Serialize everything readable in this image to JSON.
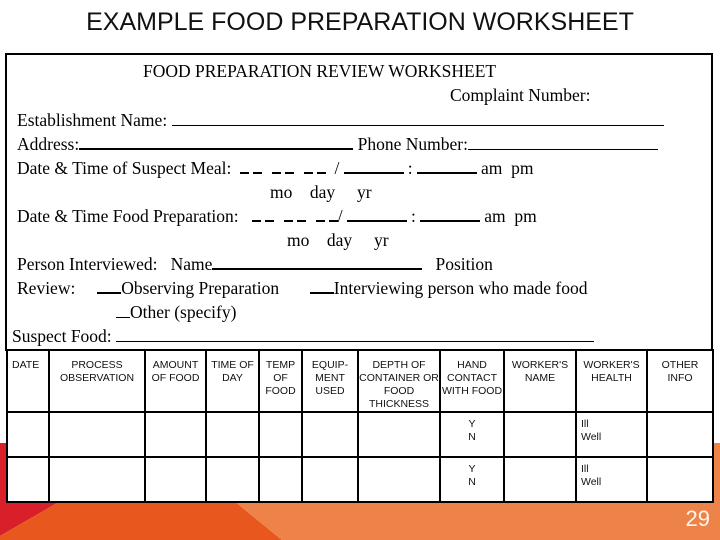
{
  "slide": {
    "title": "EXAMPLE FOOD PREPARATION WORKSHEET",
    "page_number": "29",
    "colors": {
      "red": "#d9202a",
      "dark_orange": "#e8581e",
      "light_orange": "#ee834a"
    }
  },
  "form": {
    "heading": "FOOD PREPARATION REVIEW WORKSHEET",
    "complaint_label": "Complaint Number:",
    "establishment_label": "Establishment Name:",
    "address_label": "Address:",
    "phone_label": "Phone Number:",
    "suspect_meal_label": "Date & Time of Suspect Meal:",
    "food_prep_label": "Date & Time Food Preparation:",
    "date_sep": "/",
    "time_sep": ":",
    "am": "am",
    "pm": "pm",
    "mo": "mo",
    "day": "day",
    "yr": "yr",
    "person_label": "Person Interviewed:",
    "name_label": "Name",
    "position_label": "Position",
    "review_label": "Review:",
    "review_options": [
      "Observing Preparation",
      "Interviewing person who made food",
      "Other (specify)"
    ],
    "suspect_food_label": "Suspect Food:"
  },
  "table": {
    "headers": [
      "DATE",
      "PROCESS OBSERVATION",
      "AMOUNT OF FOOD",
      "TIME OF DAY",
      "TEMP OF FOOD",
      "EQUIP- MENT USED",
      "DEPTH OF CONTAINER OR FOOD THICKNESS",
      "HAND CONTACT WITH FOOD",
      "WORKER'S NAME",
      "WORKER'S HEALTH",
      "OTHER INFO"
    ],
    "rows": [
      {
        "hand_contact": [
          "Y",
          "N"
        ],
        "worker_health": [
          "Ill",
          "Well"
        ]
      },
      {
        "hand_contact": [
          "Y",
          "N"
        ],
        "worker_health": [
          "Ill",
          "Well"
        ]
      }
    ]
  }
}
